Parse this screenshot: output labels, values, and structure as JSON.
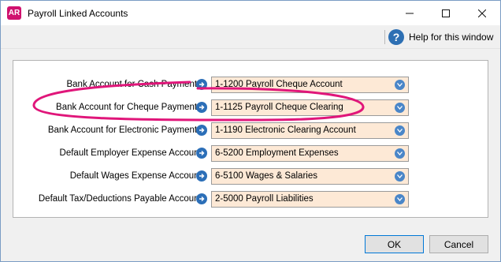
{
  "window": {
    "title": "Payroll Linked Accounts",
    "app_badge": "AR",
    "controls": {
      "minimize": "minimize-icon",
      "maximize": "maximize-icon",
      "close": "close-icon"
    }
  },
  "helpbar": {
    "help_label": "Help for this window",
    "help_icon_glyph": "?"
  },
  "rows": [
    {
      "label": "Bank Account for Cash Payments:",
      "value": "1-1200 Payroll Cheque Account"
    },
    {
      "label": "Bank Account for Cheque Payments:",
      "value": "1-1125 Payroll Cheque Clearing"
    },
    {
      "label": "Bank Account for Electronic Payments:",
      "value": "1-1190 Electronic Clearing Account"
    },
    {
      "label": "Default Employer Expense Account:",
      "value": "6-5200 Employment Expenses"
    },
    {
      "label": "Default Wages Expense Account:",
      "value": "6-5100 Wages & Salaries"
    },
    {
      "label": "Default Tax/Deductions Payable Account:",
      "value": "2-5000 Payroll Liabilities"
    }
  ],
  "buttons": {
    "ok": "OK",
    "cancel": "Cancel"
  },
  "colors": {
    "accent": "#2c6fb8",
    "select_bg": "#fde9d6",
    "highlight": "#e0167a",
    "badge": "#d0126f"
  }
}
